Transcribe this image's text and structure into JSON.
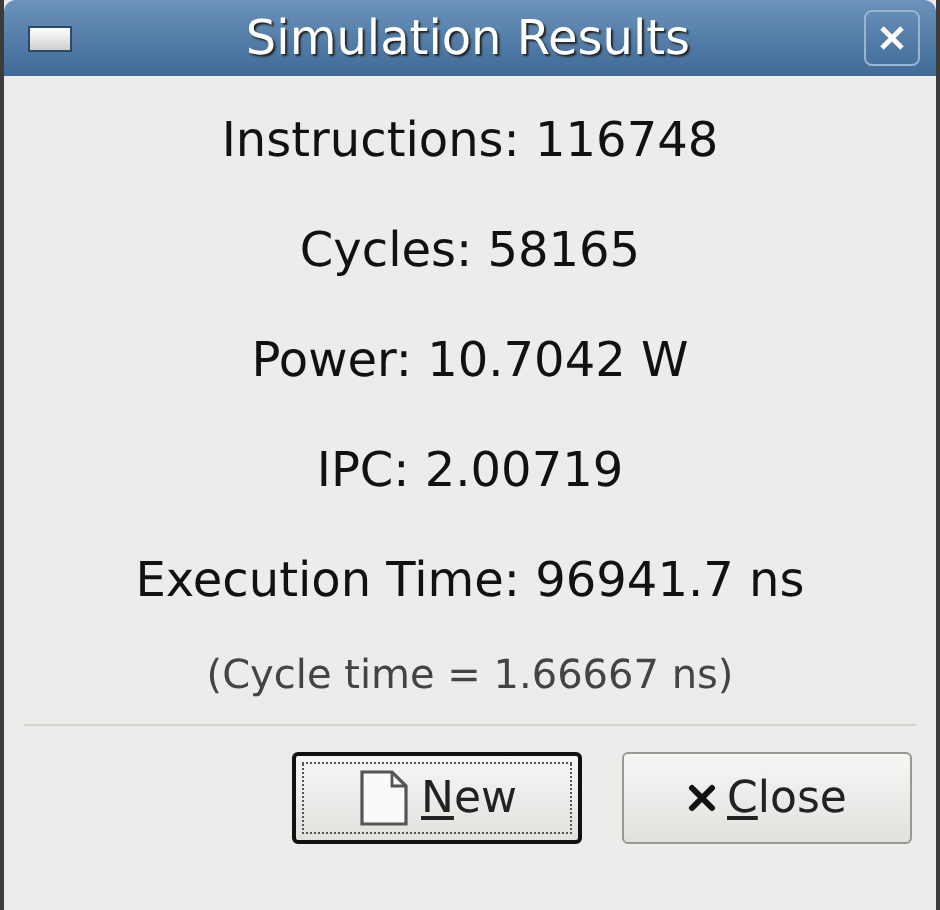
{
  "window": {
    "title": "Simulation Results"
  },
  "results": [
    "Instructions: 116748",
    "Cycles: 58165",
    "Power: 10.7042 W",
    "IPC: 2.00719",
    "Execution Time: 96941.7 ns"
  ],
  "note": "(Cycle time = 1.66667 ns)",
  "buttons": [
    {
      "kind": "new",
      "label": "New",
      "first_letter_underlined": true,
      "focused": true
    },
    {
      "kind": "close",
      "label": "Close",
      "first_letter_underlined": true,
      "focused": false
    }
  ]
}
